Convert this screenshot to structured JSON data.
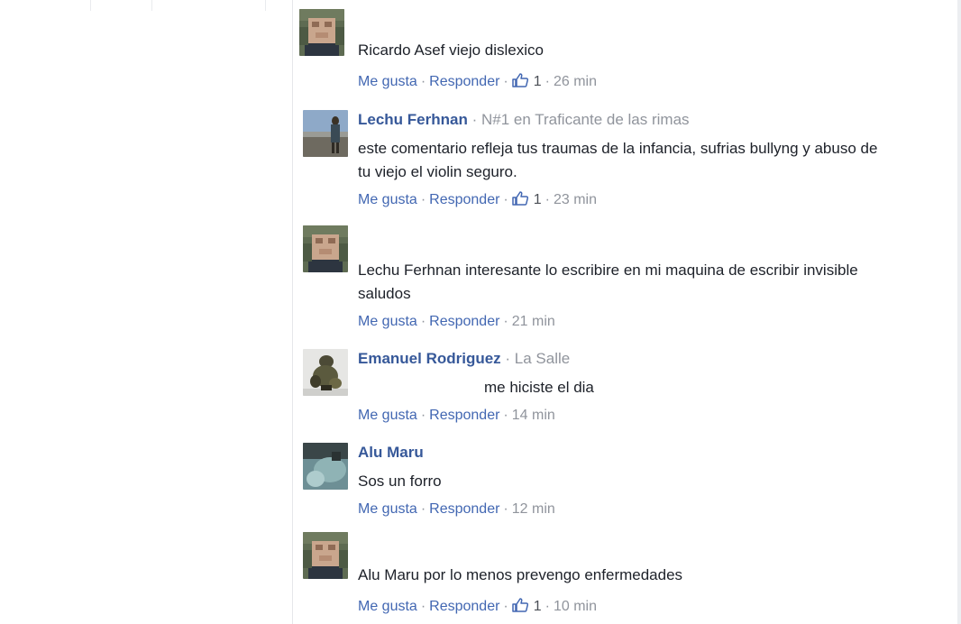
{
  "colors": {
    "author": "#365899",
    "link": "#4267b2",
    "meta": "#90949c",
    "text": "#1d2129"
  },
  "ui": {
    "like": "Me gusta",
    "reply": "Responder",
    "sep": "·"
  },
  "comments": [
    {
      "author": "",
      "meta": "",
      "text": "Ricardo Asef viejo dislexico",
      "likes": "1",
      "time": "26 min",
      "avatar": "pixelated-avatar"
    },
    {
      "author": "Lechu Ferhnan",
      "meta": "N#1 en Traficante de las rimas",
      "text": "este comentario refleja tus traumas de la infancia, sufrias bullyng y abuso de tu viejo el violin seguro.",
      "likes": "1",
      "time": "23 min",
      "avatar": "person-photo-avatar"
    },
    {
      "author": "",
      "meta": "",
      "text": "Lechu Ferhnan interesante lo escribire en mi maquina de escribir invisible saludos",
      "likes": "",
      "time": "21 min",
      "avatar": "pixelated-avatar"
    },
    {
      "author": "Emanuel Rodriguez",
      "meta": "La Salle",
      "text": "me hiciste el dia",
      "likes": "",
      "time": "14 min",
      "avatar": "figurine-photo-avatar"
    },
    {
      "author": "Alu Maru",
      "meta": "",
      "text": "Sos un forro",
      "likes": "",
      "time": "12 min",
      "avatar": "teal-photo-avatar"
    },
    {
      "author": "",
      "meta": "",
      "text": "Alu Maru por lo menos prevengo enfermedades",
      "likes": "1",
      "time": "10 min",
      "avatar": "pixelated-avatar"
    }
  ]
}
